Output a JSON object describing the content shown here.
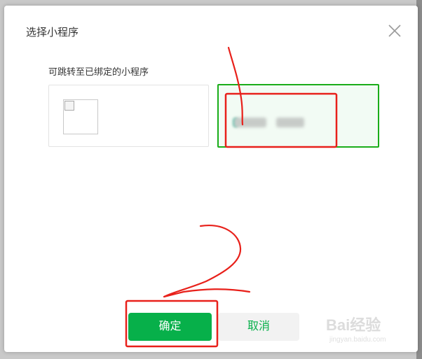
{
  "dialog": {
    "title": "选择小程序",
    "subtitle": "可跳转至已绑定的小程序",
    "ok_label": "确定",
    "cancel_label": "取消"
  },
  "colors": {
    "accent": "#07b04a",
    "selected_border": "#1aad19",
    "annotation_red": "#e8201a"
  },
  "icons": {
    "close": "close-icon",
    "broken_image": "broken-image-icon"
  },
  "watermark": {
    "brand": "Bai经验",
    "url": "jingyan.baidu.com"
  }
}
